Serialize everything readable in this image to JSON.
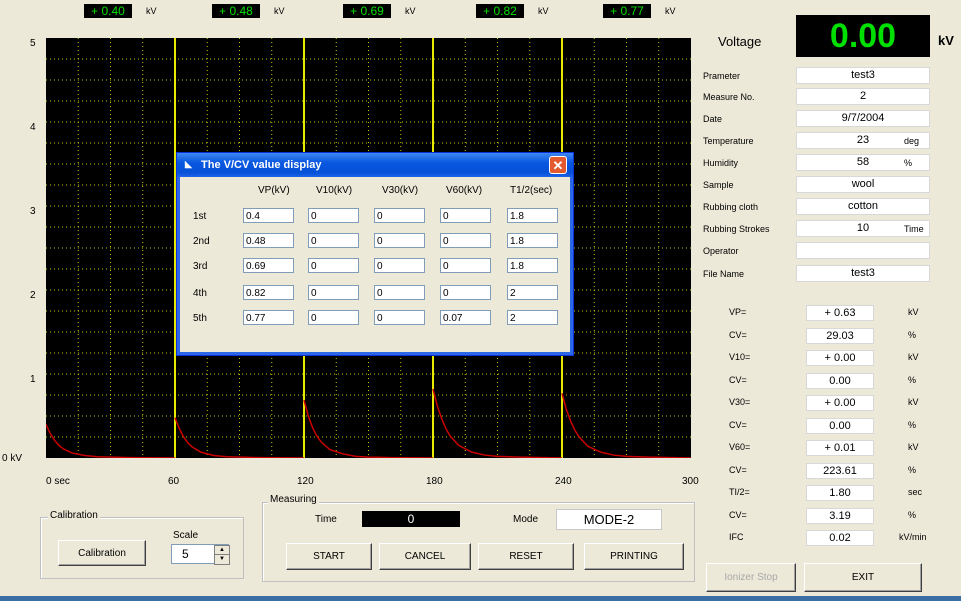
{
  "peaks": [
    {
      "value": "+ 0.40",
      "unit": "kV"
    },
    {
      "value": "+ 0.48",
      "unit": "kV"
    },
    {
      "value": "+ 0.69",
      "unit": "kV"
    },
    {
      "value": "+ 0.82",
      "unit": "kV"
    },
    {
      "value": "+ 0.77",
      "unit": "kV"
    }
  ],
  "chart_data": {
    "type": "line",
    "xlabel": "",
    "ylabel": "",
    "xlim": [
      0,
      300
    ],
    "ylim": [
      0,
      5
    ],
    "x_ticks": [
      "0 sec",
      "60",
      "120",
      "180",
      "240",
      "300"
    ],
    "y_ticks": [
      "0 kV",
      "1",
      "2",
      "3",
      "4",
      "5"
    ],
    "grid": true,
    "background": "#000000",
    "series": [
      {
        "color": "#cc0000",
        "x": [
          0,
          2,
          4,
          6,
          8,
          12,
          18,
          24,
          30,
          40,
          60
        ],
        "y": [
          0.4,
          0.29,
          0.21,
          0.15,
          0.11,
          0.06,
          0.03,
          0.015,
          0.01,
          0.005,
          0
        ]
      },
      {
        "color": "#cc0000",
        "x": [
          60,
          62,
          64,
          66,
          68,
          72,
          78,
          84,
          90,
          100,
          120
        ],
        "y": [
          0.48,
          0.35,
          0.25,
          0.18,
          0.13,
          0.07,
          0.03,
          0.015,
          0.01,
          0.005,
          0
        ]
      },
      {
        "color": "#cc0000",
        "x": [
          120,
          122,
          124,
          126,
          128,
          132,
          138,
          144,
          150,
          160,
          180
        ],
        "y": [
          0.69,
          0.5,
          0.36,
          0.26,
          0.19,
          0.1,
          0.05,
          0.02,
          0.01,
          0.005,
          0
        ]
      },
      {
        "color": "#cc0000",
        "x": [
          180,
          182,
          184,
          186,
          188,
          192,
          198,
          204,
          210,
          220,
          240
        ],
        "y": [
          0.82,
          0.62,
          0.47,
          0.35,
          0.26,
          0.15,
          0.07,
          0.035,
          0.02,
          0.01,
          0
        ]
      },
      {
        "color": "#cc0000",
        "x": [
          240,
          242,
          244,
          246,
          248,
          252,
          258,
          264,
          270,
          280,
          300
        ],
        "y": [
          0.77,
          0.58,
          0.44,
          0.33,
          0.25,
          0.14,
          0.07,
          0.035,
          0.02,
          0.01,
          0
        ]
      }
    ],
    "vlines": {
      "color": "#e8e800",
      "x": [
        60,
        120,
        180,
        240
      ]
    }
  },
  "voltage": {
    "label": "Voltage",
    "value": "0.00",
    "unit": "kV"
  },
  "params": [
    {
      "label": "Prameter",
      "value": "test3",
      "unit": ""
    },
    {
      "label": "Measure No.",
      "value": "2",
      "unit": ""
    },
    {
      "label": "Date",
      "value": "9/7/2004",
      "unit": ""
    },
    {
      "label": "Temperature",
      "value": "23",
      "unit": "deg"
    },
    {
      "label": "Humidity",
      "value": "58",
      "unit": "%"
    },
    {
      "label": "Sample",
      "value": "wool",
      "unit": ""
    },
    {
      "label": "Rubbing cloth",
      "value": "cotton",
      "unit": ""
    },
    {
      "label": "Rubbing Strokes",
      "value": "10",
      "unit": "Time"
    },
    {
      "label": "Operator",
      "value": "",
      "unit": ""
    },
    {
      "label": "File Name",
      "value": "test3",
      "unit": ""
    }
  ],
  "results": [
    {
      "label": "VP=",
      "value": "+ 0.63",
      "unit": "kV"
    },
    {
      "label": "CV=",
      "value": "29.03",
      "unit": "%"
    },
    {
      "label": "V10=",
      "value": "+ 0.00",
      "unit": "kV"
    },
    {
      "label": "CV=",
      "value": "0.00",
      "unit": "%"
    },
    {
      "label": "V30=",
      "value": "+ 0.00",
      "unit": "kV"
    },
    {
      "label": "CV=",
      "value": "0.00",
      "unit": "%"
    },
    {
      "label": "V60=",
      "value": "+ 0.01",
      "unit": "kV"
    },
    {
      "label": "CV=",
      "value": "223.61",
      "unit": "%"
    },
    {
      "label": "TI/2=",
      "value": "1.80",
      "unit": "sec"
    },
    {
      "label": "CV=",
      "value": "3.19",
      "unit": "%"
    },
    {
      "label": "IFC",
      "value": "0.02",
      "unit": "kV/min"
    }
  ],
  "calibration": {
    "legend": "Calibration",
    "button": "Calibration",
    "scale_label": "Scale",
    "scale_value": "5"
  },
  "measuring": {
    "legend": "Measuring",
    "time_label": "Time",
    "time_value": "0",
    "mode_label": "Mode",
    "mode_value": "MODE-2"
  },
  "buttons": {
    "start": "START",
    "cancel": "CANCEL",
    "reset": "RESET",
    "printing": "PRINTING",
    "ionizer_stop": "Ionizer Stop",
    "exit": "EXIT"
  },
  "dialog": {
    "title": "The V/CV value display",
    "headers": [
      "VP(kV)",
      "V10(kV)",
      "V30(kV)",
      "V60(kV)",
      "T1/2(sec)"
    ],
    "rows": [
      {
        "label": "1st",
        "cells": [
          "0.4",
          "0",
          "0",
          "0",
          "1.8"
        ]
      },
      {
        "label": "2nd",
        "cells": [
          "0.48",
          "0",
          "0",
          "0",
          "1.8"
        ]
      },
      {
        "label": "3rd",
        "cells": [
          "0.69",
          "0",
          "0",
          "0",
          "1.8"
        ]
      },
      {
        "label": "4th",
        "cells": [
          "0.82",
          "0",
          "0",
          "0",
          "2"
        ]
      },
      {
        "label": "5th",
        "cells": [
          "0.77",
          "0",
          "0",
          "0.07",
          "2"
        ]
      }
    ]
  }
}
